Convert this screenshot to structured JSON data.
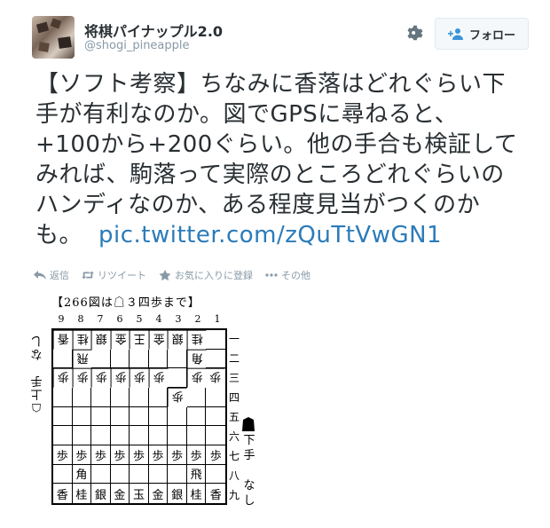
{
  "profile": {
    "display_name": "将棋パイナップル2.0",
    "screen_name": "@shogi_pineapple"
  },
  "header": {
    "follow_label": "フォロー",
    "settings_icon": "gear-icon",
    "follow_icon": "person-plus-icon"
  },
  "tweet": {
    "lines": [
      "【ソフト考察】ちなみに香落はどれぐらい下",
      "手が有利なのか。図でGPSに尋ねると、",
      "+100から+200ぐらい。他の手合も検証して",
      "みれば、駒落って実際のところどれぐらいの",
      "ハンディなのか、ある程度見当がつくのか"
    ],
    "last_line": "も。",
    "link_text": "pic.twitter.com/zQuTtVwGN1",
    "link_color": "#2b7bb9"
  },
  "actions": {
    "reply": "返信",
    "retweet": "リツイート",
    "favorite": "お気に入りに登録",
    "more": "その他"
  },
  "figure": {
    "title": "【266図は☖３四歩まで】",
    "col_labels": [
      "9",
      "8",
      "7",
      "6",
      "5",
      "4",
      "3",
      "2",
      "1"
    ],
    "row_labels": [
      "一",
      "二",
      "三",
      "四",
      "五",
      "六",
      "七",
      "八",
      "九"
    ],
    "gote_hand": "☖上手　なし",
    "sente_hand": "下手　なし",
    "board": [
      [
        "香",
        "桂",
        "銀",
        "金",
        "王",
        "金",
        "銀",
        "桂",
        ""
      ],
      [
        "",
        "飛",
        "",
        "",
        "",
        "",
        "",
        "角",
        ""
      ],
      [
        "歩",
        "歩",
        "歩",
        "歩",
        "歩",
        "歩",
        "",
        "歩",
        "歩"
      ],
      [
        "",
        "",
        "",
        "",
        "",
        "",
        "歩",
        "",
        ""
      ],
      [
        "",
        "",
        "",
        "",
        "",
        "",
        "",
        "",
        ""
      ],
      [
        "",
        "",
        "",
        "",
        "",
        "",
        "",
        "",
        ""
      ],
      [
        "歩",
        "歩",
        "歩",
        "歩",
        "歩",
        "歩",
        "歩",
        "歩",
        "歩"
      ],
      [
        "",
        "角",
        "",
        "",
        "",
        "",
        "",
        "飛",
        ""
      ],
      [
        "香",
        "桂",
        "銀",
        "金",
        "玉",
        "金",
        "銀",
        "桂",
        "香"
      ]
    ],
    "owners": [
      [
        "g",
        "g",
        "g",
        "g",
        "g",
        "g",
        "g",
        "g",
        ""
      ],
      [
        "",
        "g",
        "",
        "",
        "",
        "",
        "",
        "g",
        ""
      ],
      [
        "g",
        "g",
        "g",
        "g",
        "g",
        "g",
        "",
        "g",
        "g"
      ],
      [
        "",
        "",
        "",
        "",
        "",
        "",
        "g",
        "",
        ""
      ],
      [
        "",
        "",
        "",
        "",
        "",
        "",
        "",
        "",
        ""
      ],
      [
        "",
        "",
        "",
        "",
        "",
        "",
        "",
        "",
        ""
      ],
      [
        "s",
        "s",
        "s",
        "s",
        "s",
        "s",
        "s",
        "s",
        "s"
      ],
      [
        "",
        "s",
        "",
        "",
        "",
        "",
        "",
        "s",
        ""
      ],
      [
        "s",
        "s",
        "s",
        "s",
        "s",
        "s",
        "s",
        "s",
        "s"
      ]
    ]
  }
}
